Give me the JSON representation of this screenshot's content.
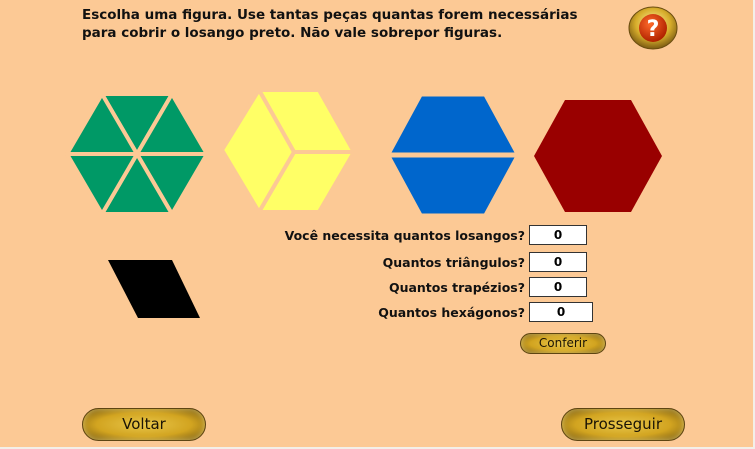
{
  "instructions": {
    "line1": "Escolha uma figura. Use tantas peças quantas forem necessárias",
    "line2": "para cobrir o losango preto. Não vale sobrepor figuras."
  },
  "help": {
    "glyph": "?",
    "icon": "question-mark-icon"
  },
  "shapes": [
    {
      "name": "hexagon-of-triangles",
      "color": "#009966"
    },
    {
      "name": "hexagon-of-rhombi",
      "color": "#ffff66"
    },
    {
      "name": "hexagon-of-trapezoids",
      "color": "#0066cc"
    },
    {
      "name": "hexagon",
      "color": "#990000"
    }
  ],
  "target": {
    "name": "black-rhombus",
    "color": "#000000"
  },
  "questions": [
    {
      "label": "Você necessita quantos losangos?",
      "value": "0"
    },
    {
      "label": "Quantos triângulos?",
      "value": "0"
    },
    {
      "label": "Quantos trapézios?",
      "value": "0"
    },
    {
      "label": "Quantos hexágonos?",
      "value": "0"
    }
  ],
  "buttons": {
    "conferir": "Conferir",
    "voltar": "Voltar",
    "prosseguir": "Prosseguir"
  },
  "colors": {
    "background": "#fcc995",
    "button_gold": "#d2a420",
    "help_red": "#cc3300"
  }
}
